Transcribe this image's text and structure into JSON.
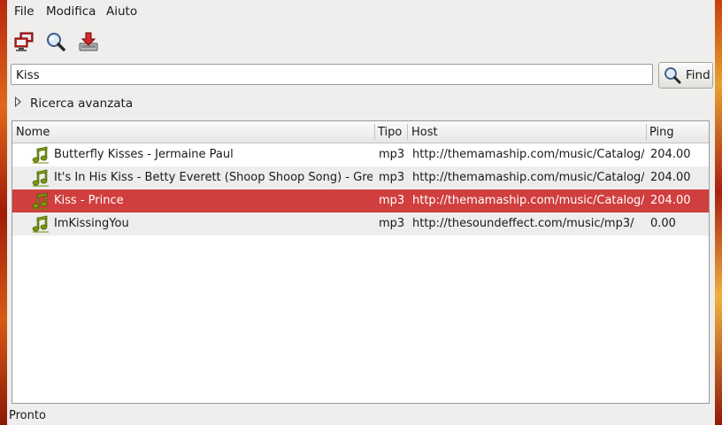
{
  "menu": {
    "file": "File",
    "edit": "Modifica",
    "help": "Aiuto"
  },
  "toolbar": {
    "icons": [
      "network-icon",
      "search-icon",
      "download-icon"
    ]
  },
  "search": {
    "value": "Kiss",
    "find_label": "Find"
  },
  "advanced": {
    "label": "Ricerca avanzata"
  },
  "table": {
    "headers": {
      "name": "Nome",
      "type": "Tipo",
      "host": "Host",
      "ping": "Ping"
    },
    "rows": [
      {
        "name": "Butterfly Kisses - Jermaine Paul",
        "type": "mp3",
        "host": "http://themamaship.com/music/Catalog/",
        "ping": "204.00"
      },
      {
        "name": "It's In His Kiss - Betty Everett (Shoop Shoop Song) - Gre",
        "type": "mp3",
        "host": "http://themamaship.com/music/Catalog/",
        "ping": "204.00"
      },
      {
        "name": "Kiss - Prince",
        "type": "mp3",
        "host": "http://themamaship.com/music/Catalog/",
        "ping": "204.00"
      },
      {
        "name": "ImKissingYou",
        "type": "mp3",
        "host": "http://thesoundeffect.com/music/mp3/",
        "ping": "0.00"
      }
    ],
    "selected_row": 2
  },
  "status": {
    "text": "Pronto"
  },
  "colors": {
    "selection": "#d03e3e",
    "music_icon": "#7a9a10"
  }
}
